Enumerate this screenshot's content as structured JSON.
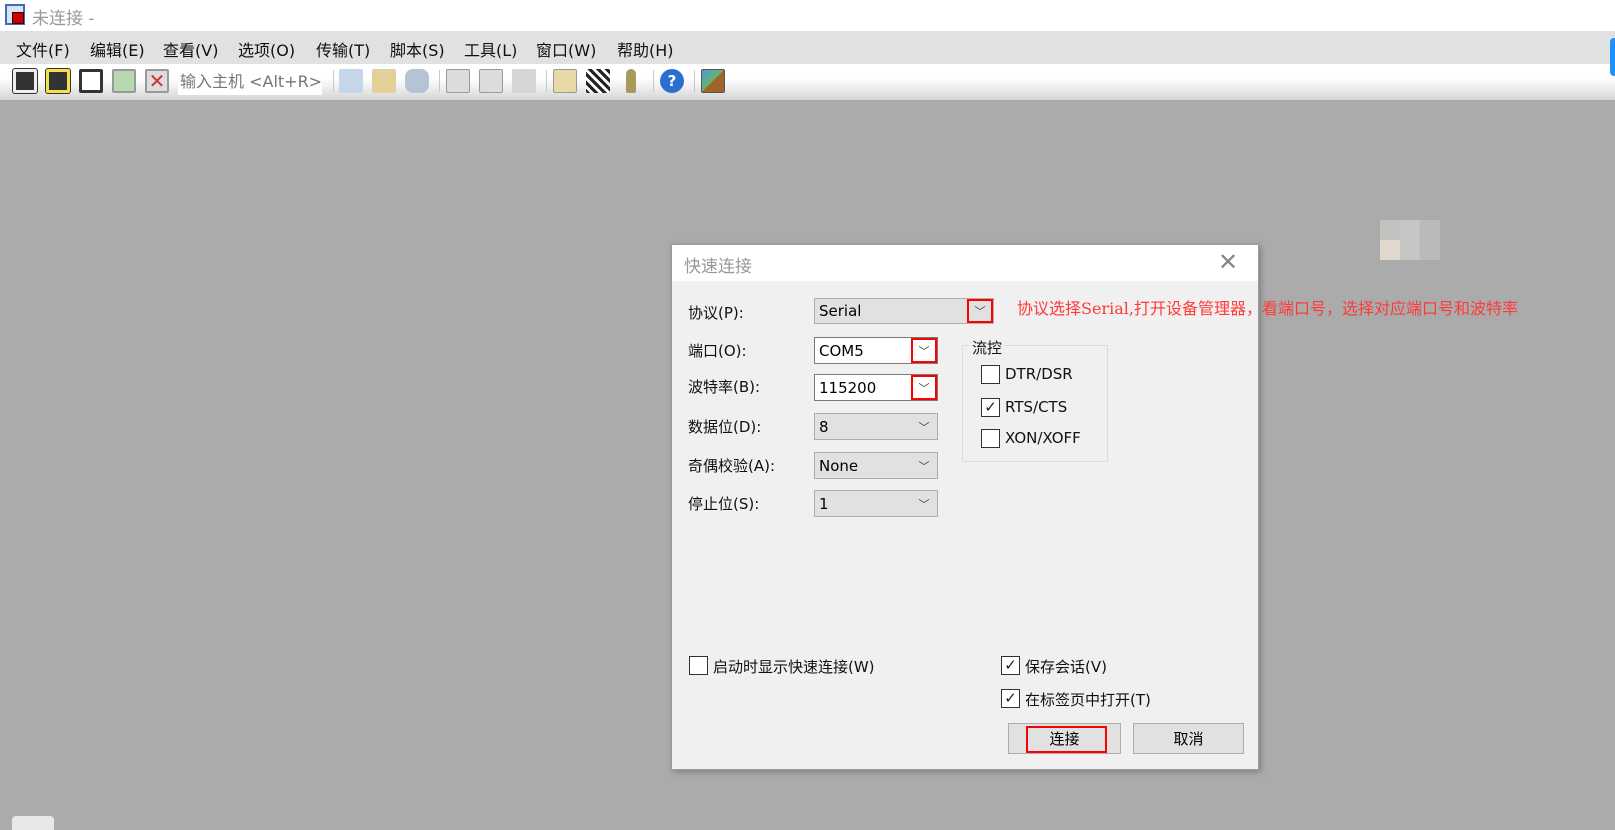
{
  "window": {
    "title": "未连接 -"
  },
  "menu": [
    "文件(F)",
    "编辑(E)",
    "查看(V)",
    "选项(O)",
    "传输(T)",
    "脚本(S)",
    "工具(L)",
    "窗口(W)",
    "帮助(H)"
  ],
  "toolbar": {
    "host_placeholder": "输入主机 <Alt+R>",
    "icons": [
      "connect-icon",
      "quick-connect-icon",
      "connect-tab-icon",
      "reconnect-icon",
      "disconnect-icon",
      "copy-icon",
      "paste-icon",
      "find-icon",
      "print-setup-icon",
      "print-icon",
      "printer-icon",
      "session-options-icon",
      "global-options-icon",
      "keymap-icon",
      "help-icon",
      "about-icon"
    ]
  },
  "dialog": {
    "title": "快速连接",
    "fields": [
      {
        "label": "协议(P):",
        "value": "Serial"
      },
      {
        "label": "端口(O):",
        "value": "COM5"
      },
      {
        "label": "波特率(B):",
        "value": "115200"
      },
      {
        "label": "数据位(D):",
        "value": "8"
      },
      {
        "label": "奇偶校验(A):",
        "value": "None"
      },
      {
        "label": "停止位(S):",
        "value": "1"
      }
    ],
    "flow_control": {
      "legend": "流控",
      "options": [
        {
          "label": "DTR/DSR",
          "checked": false
        },
        {
          "label": "RTS/CTS",
          "checked": true
        },
        {
          "label": "XON/XOFF",
          "checked": false
        }
      ]
    },
    "show_on_startup": {
      "label": "启动时显示快速连接(W)",
      "checked": false
    },
    "save_session": {
      "label": "保存会话(V)",
      "checked": true
    },
    "open_in_tab": {
      "label": "在标签页中打开(T)",
      "checked": true
    },
    "connect_label": "连接",
    "cancel_label": "取消"
  },
  "annotation": "协议选择Serial,打开设备管理器，看端口号，选择对应端口号和波特率",
  "colors": {
    "highlight": "#ff0000",
    "annotation": "#ff3a3a",
    "workspace": "#ababab"
  }
}
